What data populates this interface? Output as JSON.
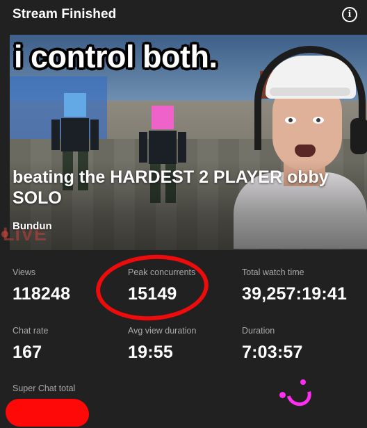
{
  "header": {
    "title": "Stream Finished",
    "info_icon": "info-icon"
  },
  "thumbnail": {
    "caption": "i control both.",
    "live_badge": "LIVE"
  },
  "stream": {
    "title": "beating the HARDEST 2 PLAYER obby SOLO",
    "channel": "Bundun"
  },
  "stats": {
    "views": {
      "label": "Views",
      "value": "118248"
    },
    "peak_concurrents": {
      "label": "Peak concurrents",
      "value": "15149"
    },
    "total_watch_time": {
      "label": "Total watch time",
      "value": "39,257:19:41"
    },
    "chat_rate": {
      "label": "Chat rate",
      "value": "167"
    },
    "avg_view_duration": {
      "label": "Avg view duration",
      "value": "19:55"
    },
    "duration": {
      "label": "Duration",
      "value": "7:03:57"
    },
    "super_chat_total": {
      "label": "Super Chat total",
      "value": ""
    }
  },
  "annotations": {
    "circle_color": "#ee0b0b",
    "redaction_color": "#ff0808",
    "smiley_color": "#ff2ef0"
  }
}
